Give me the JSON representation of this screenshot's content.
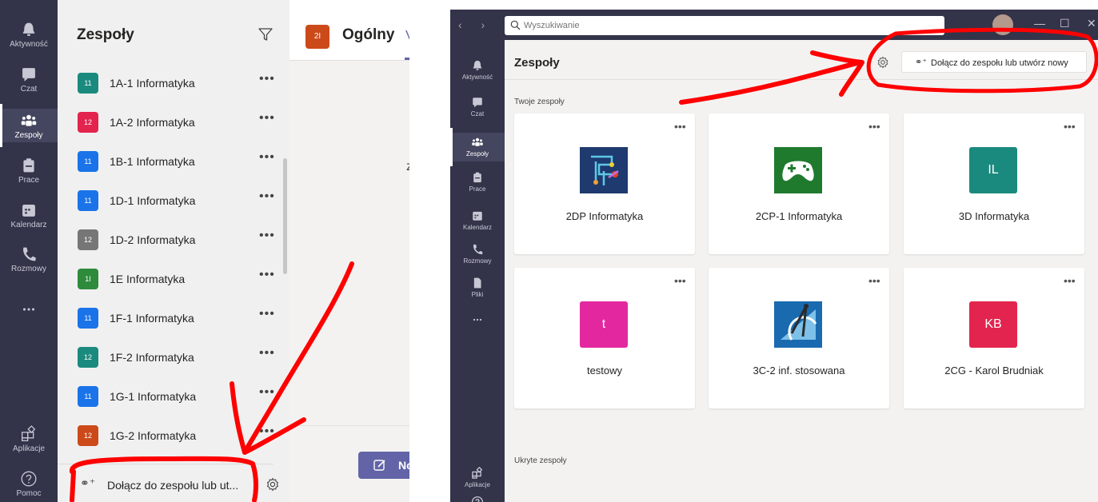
{
  "left": {
    "rail": [
      {
        "label": "Aktywność",
        "icon": "bell-icon"
      },
      {
        "label": "Czat",
        "icon": "chat-icon"
      },
      {
        "label": "Zespoły",
        "icon": "teams-icon",
        "active": true
      },
      {
        "label": "Prace",
        "icon": "assignments-icon"
      },
      {
        "label": "Kalendarz",
        "icon": "calendar-icon"
      },
      {
        "label": "Rozmowy",
        "icon": "phone-icon"
      },
      {
        "label": "",
        "icon": "more-icon"
      },
      {
        "label": "Aplikacje",
        "icon": "apps-icon"
      },
      {
        "label": "Pomoc",
        "icon": "help-icon"
      }
    ],
    "title": "Zespoły",
    "teams": [
      {
        "badge": "11",
        "name": "1A-1 Informatyka",
        "color": "#1b8a7e"
      },
      {
        "badge": "12",
        "name": "1A-2 Informatyka",
        "color": "#e3244e"
      },
      {
        "badge": "11",
        "name": "1B-1 Informatyka",
        "color": "#1a73e8"
      },
      {
        "badge": "11",
        "name": "1D-1 Informatyka",
        "color": "#1a73e8"
      },
      {
        "badge": "12",
        "name": "1D-2 Informatyka",
        "color": "#767676"
      },
      {
        "badge": "1I",
        "name": "1E Informatyka",
        "color": "#2e8b3c"
      },
      {
        "badge": "11",
        "name": "1F-1 Informatyka",
        "color": "#1a73e8"
      },
      {
        "badge": "12",
        "name": "1F-2 Informatyka",
        "color": "#1b8a7e"
      },
      {
        "badge": "11",
        "name": "1G-1 Informatyka",
        "color": "#1a73e8"
      },
      {
        "badge": "12",
        "name": "1G-2 Informatyka",
        "color": "#cc4a1a"
      }
    ],
    "join_label": "Dołącz do zespołu lub ut...",
    "channel": {
      "badge": "2I",
      "title": "Ogólny",
      "tab_fragment": "V",
      "frag": "z",
      "new_label": "No"
    }
  },
  "right": {
    "search_placeholder": "Wyszukiwanie",
    "rail": [
      {
        "label": "Aktywność",
        "icon": "bell-icon"
      },
      {
        "label": "Czat",
        "icon": "chat-icon"
      },
      {
        "label": "Zespoły",
        "icon": "teams-icon",
        "active": true
      },
      {
        "label": "Prace",
        "icon": "assignments-icon"
      },
      {
        "label": "Kalendarz",
        "icon": "calendar-icon"
      },
      {
        "label": "Rozmowy",
        "icon": "phone-icon"
      },
      {
        "label": "Pliki",
        "icon": "files-icon"
      },
      {
        "label": "",
        "icon": "more-icon"
      },
      {
        "label": "Aplikacje",
        "icon": "apps-icon"
      },
      {
        "label": "Pomoc",
        "icon": "help-icon"
      }
    ],
    "title": "Zespoły",
    "join_label": "Dołącz do zespołu lub utwórz nowy",
    "section_yours": "Twoje zespoły",
    "section_hidden": "Ukryte zespoły",
    "cards": [
      {
        "name": "2DP Informatyka",
        "logo": "circuit-logo",
        "color": "#1e3a6e",
        "initials": ""
      },
      {
        "name": "2CP-1 Informatyka",
        "logo": "gamepad-logo",
        "color": "#1f7a2e",
        "initials": ""
      },
      {
        "name": "3D Informatyka",
        "logo": "initials",
        "color": "#1b8a7e",
        "initials": "IL"
      },
      {
        "name": "testowy",
        "logo": "initials",
        "color": "#e3289f",
        "initials": "t"
      },
      {
        "name": "3C-2 inf. stosowana",
        "logo": "geometry-logo",
        "color": "#1a6ab0",
        "initials": ""
      },
      {
        "name": "2CG - Karol Brudniak",
        "logo": "initials",
        "color": "#e3244e",
        "initials": "KB"
      }
    ]
  },
  "colors": {
    "rail": "#33344a",
    "accent": "#6264a7",
    "annotation": "#ff0000"
  }
}
